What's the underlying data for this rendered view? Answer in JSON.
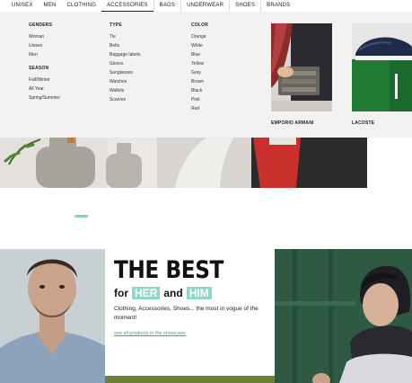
{
  "nav": {
    "items": [
      "UNISEX",
      "MEN",
      "CLOTHING",
      "ACCESSORIES",
      "BAGS",
      "UNDERWEAR",
      "SHOES",
      "BRANDS"
    ],
    "active": "ACCESSORIES"
  },
  "mega": {
    "genders": {
      "heading": "GENDERS",
      "items": [
        "Woman",
        "Unisex",
        "Men"
      ]
    },
    "season": {
      "heading": "SEASON",
      "items": [
        "Fall/Winter",
        "All Year",
        "Spring/Summer"
      ]
    },
    "type": {
      "heading": "TYPE",
      "items": [
        "Tie",
        "Belts",
        "Baggage labels",
        "Gloves",
        "Sunglasses",
        "Watches",
        "Wallets",
        "Scarves"
      ]
    },
    "color": {
      "heading": "COLOR",
      "items": [
        "Orange",
        "White",
        "Blue",
        "Yellow",
        "Gray",
        "Brown",
        "Black",
        "Pink",
        "Red"
      ]
    },
    "brands": [
      {
        "name": "EMPORIO ARMANI",
        "image": "wallet-photo"
      },
      {
        "name": "LACOSTE",
        "image": "sneaker-photo"
      }
    ]
  },
  "promo": {
    "title": "THE BEST",
    "for": "for",
    "her": "HER",
    "and": "and",
    "him": "HIM",
    "description": "Clothing, Accessories, Shoes... the most in vogue of the moment!",
    "link": "see all products in the showcase"
  },
  "colors": {
    "accent": "#8fd7c8",
    "link": "#3aa58f",
    "menu_bg": "#f2f2f2"
  }
}
